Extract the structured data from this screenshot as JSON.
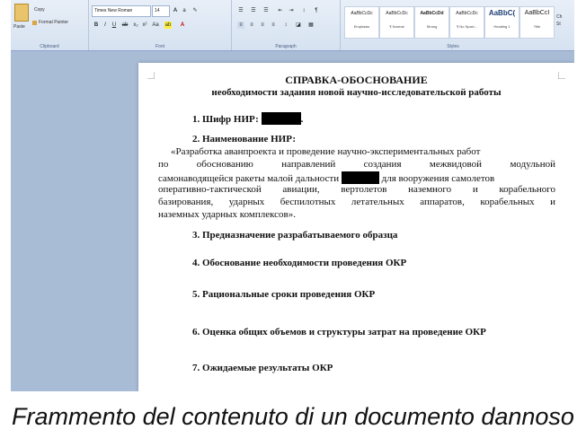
{
  "ribbon": {
    "clipboard": {
      "paste_label": "Paste",
      "copy_label": "Copy",
      "format_painter_label": "Format Painter",
      "group_label": "Clipboard"
    },
    "font": {
      "font_name": "Times New Roman",
      "font_size": "14",
      "group_label": "Font"
    },
    "paragraph": {
      "group_label": "Paragraph"
    },
    "styles": {
      "group_label": "Styles",
      "items": [
        {
          "preview": "AaBbCcDc",
          "name": "Emphasis"
        },
        {
          "preview": "AaBbCcDc",
          "name": "¶ Normal"
        },
        {
          "preview": "AaBbCcDd",
          "name": "Strong"
        },
        {
          "preview": "AaBbCcDc",
          "name": "¶ No Spaci..."
        },
        {
          "preview": "AaBbC(",
          "name": "Heading 1"
        },
        {
          "preview": "AaBbCcI",
          "name": "Title"
        }
      ],
      "change_label_1": "Ch",
      "change_label_2": "St"
    }
  },
  "document": {
    "title": "СПРАВКА-ОБОСНОВАНИЕ",
    "subtitle": "необходимости задания новой научно-исследовательской работы",
    "item1_label": "1. Шифр НИР:",
    "item1_tail": ".",
    "item2_label": "2. Наименование НИР:",
    "para_line1": "«Разработка аванпроекта и проведение научно-экспериментальных работ",
    "para_line2": "по обоснованию направлений создания межвидовой модульной",
    "para_line3a": "самонаводящейся ракеты малой дальности",
    "para_line3b": "для вооружения самолетов",
    "para_line4": "оперативно-тактической авиации, вертолетов наземного и корабельного",
    "para_line5": "базирования, ударных беспилотных летательных аппаратов, корабельных и",
    "para_line6": "наземных ударных комплексов».",
    "item3": "3. Предназначение разрабатываемого образца",
    "item4": "4. Обоснование необходимости проведения ОКР",
    "item5": "5. Рациональные сроки проведения ОКР",
    "item6": "6. Оценка общих объемов и структуры затрат на проведение ОКР",
    "item7": "7. Ожидаемые результаты ОКР"
  },
  "caption": "Frammento del contenuto di un documento dannoso",
  "colors": {
    "ribbon_bg": "#dce7f4",
    "workspace_bg": "#a9bcd6",
    "page_bg": "#ffffff",
    "redaction": "#000000"
  }
}
